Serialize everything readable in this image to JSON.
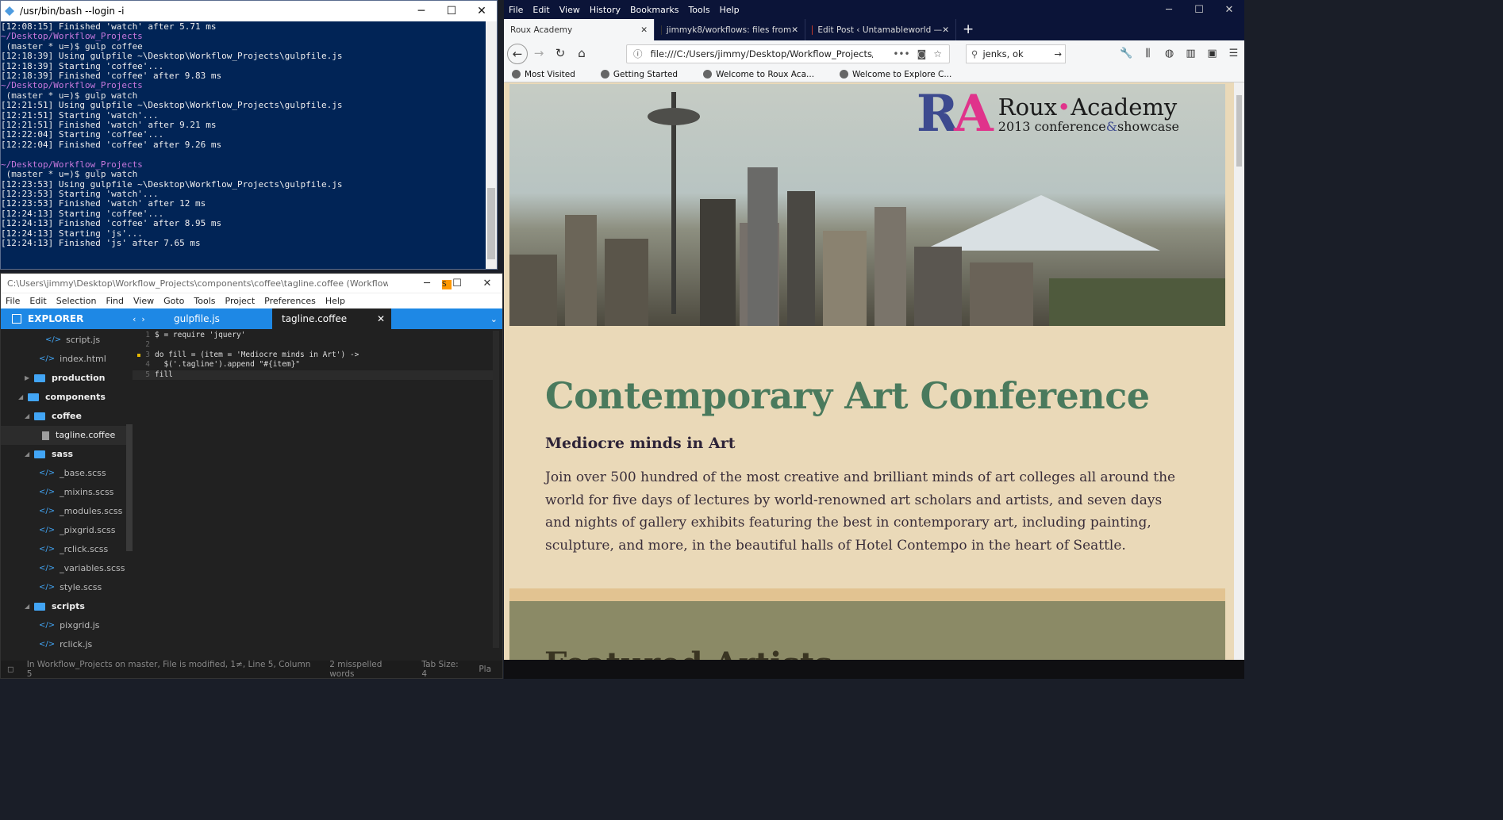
{
  "terminal": {
    "title": "/usr/bin/bash --login -i",
    "lines": [
      {
        "t": "[12:08:15] Finished 'watch' after 5.71 ms",
        "k": ""
      },
      {
        "t": "~/Desktop/Workflow_Projects",
        "k": "path"
      },
      {
        "t": " (master * u=)$ gulp coffee",
        "k": "prompt"
      },
      {
        "t": "[12:18:39] Using gulpfile ~\\Desktop\\Workflow_Projects\\gulpfile.js",
        "k": ""
      },
      {
        "t": "[12:18:39] Starting 'coffee'...",
        "k": ""
      },
      {
        "t": "[12:18:39] Finished 'coffee' after 9.83 ms",
        "k": ""
      },
      {
        "t": "~/Desktop/Workflow_Projects",
        "k": "path"
      },
      {
        "t": " (master * u=)$ gulp watch",
        "k": "prompt"
      },
      {
        "t": "[12:21:51] Using gulpfile ~\\Desktop\\Workflow_Projects\\gulpfile.js",
        "k": ""
      },
      {
        "t": "[12:21:51] Starting 'watch'...",
        "k": ""
      },
      {
        "t": "[12:21:51] Finished 'watch' after 9.21 ms",
        "k": ""
      },
      {
        "t": "[12:22:04] Starting 'coffee'...",
        "k": ""
      },
      {
        "t": "[12:22:04] Finished 'coffee' after 9.26 ms",
        "k": ""
      },
      {
        "t": "",
        "k": ""
      },
      {
        "t": "~/Desktop/Workflow_Projects",
        "k": "path"
      },
      {
        "t": " (master * u=)$ gulp watch",
        "k": "prompt"
      },
      {
        "t": "[12:23:53] Using gulpfile ~\\Desktop\\Workflow_Projects\\gulpfile.js",
        "k": ""
      },
      {
        "t": "[12:23:53] Starting 'watch'...",
        "k": ""
      },
      {
        "t": "[12:23:53] Finished 'watch' after 12 ms",
        "k": ""
      },
      {
        "t": "[12:24:13] Starting 'coffee'...",
        "k": ""
      },
      {
        "t": "[12:24:13] Finished 'coffee' after 8.95 ms",
        "k": ""
      },
      {
        "t": "[12:24:13] Starting 'js'...",
        "k": ""
      },
      {
        "t": "[12:24:13] Finished 'js' after 7.65 ms",
        "k": ""
      }
    ]
  },
  "sublime": {
    "title": "C:\\Users\\jimmy\\Desktop\\Workflow_Projects\\components\\coffee\\tagline.coffee (Workflow_Projects) - Sublime...",
    "menu": [
      "File",
      "Edit",
      "Selection",
      "Find",
      "View",
      "Goto",
      "Tools",
      "Project",
      "Preferences",
      "Help"
    ],
    "explorer_label": "EXPLORER",
    "tabs": [
      "gulpfile.js",
      "tagline.coffee"
    ],
    "tree": [
      {
        "label": "script.js",
        "type": "code",
        "indent": 56
      },
      {
        "label": "index.html",
        "type": "code",
        "indent": 48
      },
      {
        "label": "production",
        "type": "folder",
        "indent": 30
      },
      {
        "label": "components",
        "type": "folder-open",
        "indent": 22
      },
      {
        "label": "coffee",
        "type": "folder-open",
        "indent": 30
      },
      {
        "label": "tagline.coffee",
        "type": "file",
        "indent": 52,
        "selected": true
      },
      {
        "label": "sass",
        "type": "folder-open",
        "indent": 30
      },
      {
        "label": "_base.scss",
        "type": "code",
        "indent": 48
      },
      {
        "label": "_mixins.scss",
        "type": "code",
        "indent": 48
      },
      {
        "label": "_modules.scss",
        "type": "code",
        "indent": 48
      },
      {
        "label": "_pixgrid.scss",
        "type": "code",
        "indent": 48
      },
      {
        "label": "_rclick.scss",
        "type": "code",
        "indent": 48
      },
      {
        "label": "_variables.scss",
        "type": "code",
        "indent": 48
      },
      {
        "label": "style.scss",
        "type": "code",
        "indent": 48
      },
      {
        "label": "scripts",
        "type": "folder-open",
        "indent": 30
      },
      {
        "label": "pixgrid.js",
        "type": "code",
        "indent": 48
      },
      {
        "label": "rclick.js",
        "type": "code",
        "indent": 48
      }
    ],
    "code": [
      "$ = require 'jquery'",
      "",
      "do fill = (item = 'Mediocre minds in Art') ->",
      "  $('.tagline').append \"#{item}\"",
      "fill"
    ],
    "status": [
      "In Workflow_Projects on master, File is modified, 1≠, Line 5, Column 5",
      "2 misspelled words",
      "Tab Size: 4",
      "Pla"
    ]
  },
  "firefox": {
    "menu": [
      "File",
      "Edit",
      "View",
      "History",
      "Bookmarks",
      "Tools",
      "Help"
    ],
    "tabs": [
      "Roux Academy",
      "jimmyk8/workflows: files from",
      "Edit Post ‹ Untamableworld —"
    ],
    "url": "file:///C:/Users/jimmy/Desktop/Workflow_Projects/builds",
    "search": "jenks, ok",
    "bookmarks": [
      "Most Visited",
      "Getting Started",
      "Welcome to Roux Aca...",
      "Welcome to Explore C..."
    ],
    "page": {
      "logo_mark_r": "R",
      "logo_mark_a": "A",
      "logo_name_1": "Roux",
      "logo_dot": "•",
      "logo_name_2": "Academy",
      "logo_sub_1": "2013 conference",
      "logo_amp": "&",
      "logo_sub_2": "showcase",
      "heading": "Contemporary Art Conference",
      "tagline": "Mediocre minds in Art",
      "body": "Join over 500 hundred of the most creative and brilliant minds of art colleges all around the world for five days of lectures by world-renowned art scholars and artists, and seven days and nights of gallery exhibits featuring the best in contemporary art, including painting, sculpture, and more, in the beautiful halls of Hotel Contempo in the heart of Seattle.",
      "next_section": "Featured Artists"
    }
  }
}
